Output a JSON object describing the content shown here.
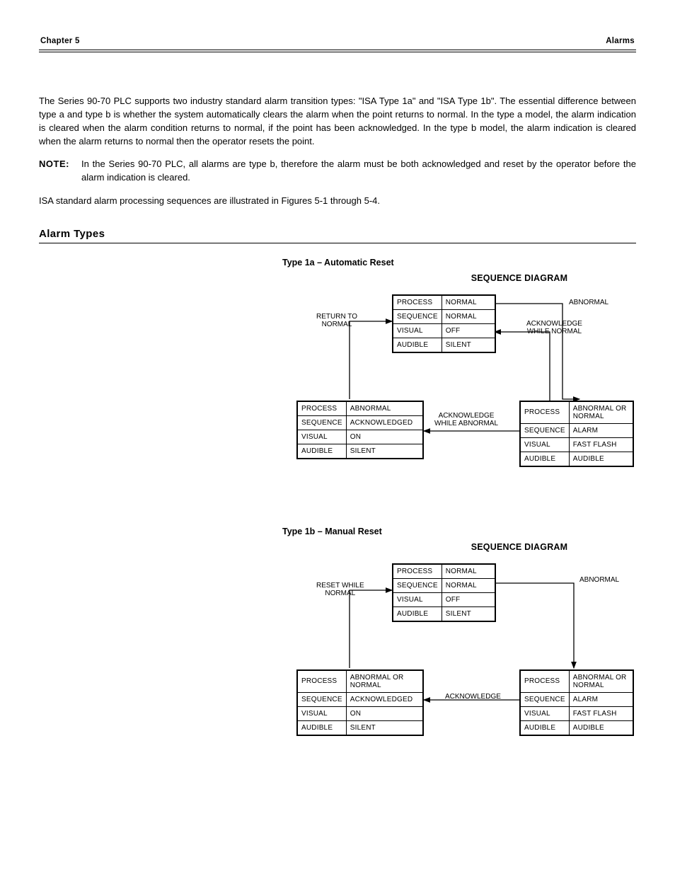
{
  "header": {
    "left": "Chapter 5",
    "right": "Alarms"
  },
  "intro": {
    "p1": "The Series 90-70 PLC supports two industry standard alarm transition types: \"ISA Type 1a\" and \"ISA Type 1b\". The essential difference between type a and type b is whether the system automatically clears the alarm when the point returns to normal. In the type a model, the alarm indication is cleared when the alarm condition returns to normal, if the point has been acknowledged. In the type b model, the alarm indication is cleared when the alarm returns to normal then the operator resets the point.",
    "noteLabel": "NOTE:",
    "note": "In the Series 90-70 PLC, all alarms are type b, therefore the alarm must be both acknowledged and reset by the operator before the alarm indication is cleared.",
    "p2": "ISA standard alarm processing sequences are illustrated in Figures 5-1 through 5-4."
  },
  "types_heading": "Alarm Types",
  "type1a": {
    "label": "Type 1a – Automatic Reset",
    "title": "SEQUENCE DIAGRAM",
    "top": {
      "r0c0": "PROCESS",
      "r0c1": "NORMAL",
      "r1c0": "SEQUENCE",
      "r1c1": "NORMAL",
      "r2c0": "VISUAL",
      "r2c1": "OFF",
      "r3c0": "AUDIBLE",
      "r3c1": "SILENT"
    },
    "left": {
      "r0c0": "PROCESS",
      "r0c1": "ABNORMAL",
      "r1c0": "SEQUENCE",
      "r1c1": "ACKNOWLEDGED",
      "r2c0": "VISUAL",
      "r2c1": "ON",
      "r3c0": "AUDIBLE",
      "r3c1": "SILENT"
    },
    "right": {
      "r0c0": "PROCESS",
      "r0c1": "ABNORMAL OR NORMAL",
      "r1c0": "SEQUENCE",
      "r1c1": "ALARM",
      "r2c0": "VISUAL",
      "r2c1": "FAST FLASH",
      "r3c0": "AUDIBLE",
      "r3c1": "AUDIBLE"
    },
    "edge_return": "RETURN TO\nNORMAL",
    "edge_abnormal": "ABNORMAL",
    "edge_acknorm": "ACKNOWLEDGE\nWHILE NORMAL",
    "edge_ackabn": "ACKNOWLEDGE\nWHILE ABNORMAL"
  },
  "type1b": {
    "label": "Type 1b – Manual Reset",
    "title": "SEQUENCE DIAGRAM",
    "top": {
      "r0c0": "PROCESS",
      "r0c1": "NORMAL",
      "r1c0": "SEQUENCE",
      "r1c1": "NORMAL",
      "r2c0": "VISUAL",
      "r2c1": "OFF",
      "r3c0": "AUDIBLE",
      "r3c1": "SILENT"
    },
    "left": {
      "r0c0": "PROCESS",
      "r0c1": "ABNORMAL OR NORMAL",
      "r1c0": "SEQUENCE",
      "r1c1": "ACKNOWLEDGED",
      "r2c0": "VISUAL",
      "r2c1": "ON",
      "r3c0": "AUDIBLE",
      "r3c1": "SILENT"
    },
    "right": {
      "r0c0": "PROCESS",
      "r0c1": "ABNORMAL OR NORMAL",
      "r1c0": "SEQUENCE",
      "r1c1": "ALARM",
      "r2c0": "VISUAL",
      "r2c1": "FAST FLASH",
      "r3c0": "AUDIBLE",
      "r3c1": "AUDIBLE"
    },
    "edge_reset": "RESET WHILE\nNORMAL",
    "edge_abnormal": "ABNORMAL",
    "edge_ack": "ACKNOWLEDGE"
  }
}
